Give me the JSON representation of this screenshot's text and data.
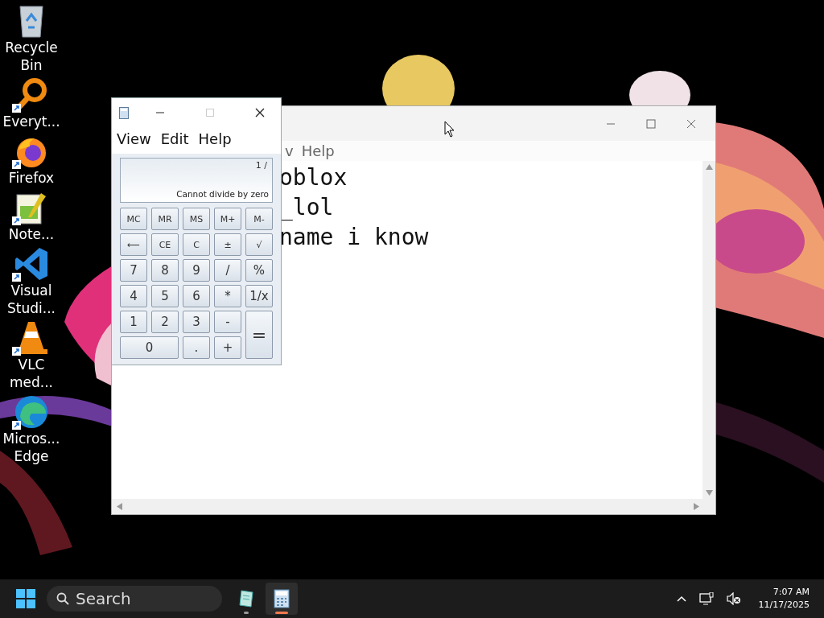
{
  "desktop_icons": [
    {
      "kind": "recycle",
      "label": "Recycle Bin",
      "shortcut": false
    },
    {
      "kind": "search",
      "label": "Everyt...",
      "shortcut": true
    },
    {
      "kind": "firefox",
      "label": "Firefox",
      "shortcut": true
    },
    {
      "kind": "notepadpp",
      "label": "Note...",
      "shortcut": true
    },
    {
      "kind": "vscode",
      "label": "Visual Studi...",
      "shortcut": true
    },
    {
      "kind": "vlc",
      "label": "VLC med...",
      "shortcut": true
    },
    {
      "kind": "edge",
      "label": "Micros... Edge",
      "shortcut": true
    }
  ],
  "notepad": {
    "menu": [
      "v",
      "Help"
    ],
    "lines": [
      "oblox",
      "_lol",
      "name i know"
    ]
  },
  "calculator": {
    "menu": [
      "View",
      "Edit",
      "Help"
    ],
    "expression": "1 /",
    "display": "Cannot divide by zero",
    "keys": [
      {
        "label": "MC",
        "kind": "key"
      },
      {
        "label": "MR",
        "kind": "key"
      },
      {
        "label": "MS",
        "kind": "key"
      },
      {
        "label": "M+",
        "kind": "key"
      },
      {
        "label": "M-",
        "kind": "key"
      },
      {
        "label": "⟵",
        "kind": "key"
      },
      {
        "label": "CE",
        "kind": "key"
      },
      {
        "label": "C",
        "kind": "key"
      },
      {
        "label": "±",
        "kind": "key"
      },
      {
        "label": "√",
        "kind": "key"
      },
      {
        "label": "7",
        "kind": "key"
      },
      {
        "label": "8",
        "kind": "key"
      },
      {
        "label": "9",
        "kind": "key"
      },
      {
        "label": "/",
        "kind": "key"
      },
      {
        "label": "%",
        "kind": "key"
      },
      {
        "label": "4",
        "kind": "key"
      },
      {
        "label": "5",
        "kind": "key"
      },
      {
        "label": "6",
        "kind": "key"
      },
      {
        "label": "*",
        "kind": "key"
      },
      {
        "label": "1/x",
        "kind": "key"
      },
      {
        "label": "1",
        "kind": "key"
      },
      {
        "label": "2",
        "kind": "key"
      },
      {
        "label": "3",
        "kind": "key"
      },
      {
        "label": "-",
        "kind": "key"
      },
      {
        "label": "=",
        "kind": "tall"
      },
      {
        "label": "0",
        "kind": "wide"
      },
      {
        "label": ".",
        "kind": "key"
      },
      {
        "label": "+",
        "kind": "key"
      }
    ]
  },
  "taskbar": {
    "search": {
      "placeholder": "Search"
    },
    "apps": [
      {
        "kind": "notepad",
        "selected": false
      },
      {
        "kind": "calculator",
        "selected": true
      }
    ],
    "time": "7:07 AM",
    "date": "11/17/2025"
  }
}
